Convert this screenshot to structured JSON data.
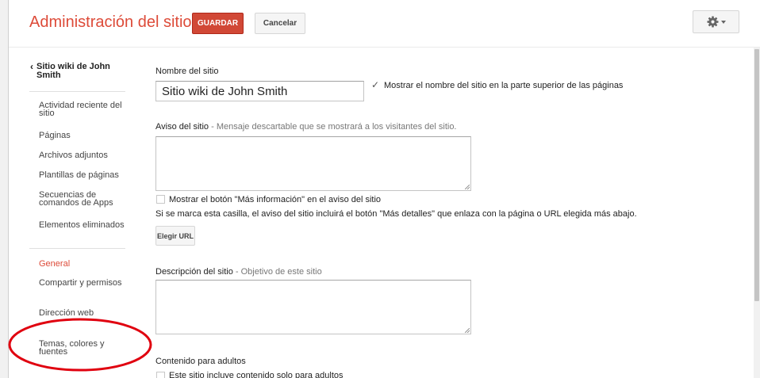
{
  "header": {
    "title": "Administración del sitio",
    "save_label": "GUARDAR",
    "cancel_label": "Cancelar",
    "settings_icon": "gear-icon"
  },
  "sidebar": {
    "back_label": "Sitio wiki de John Smith",
    "group1": [
      {
        "label": "Actividad reciente del sitio"
      },
      {
        "label": "Páginas"
      },
      {
        "label": "Archivos adjuntos"
      },
      {
        "label": "Plantillas de páginas"
      },
      {
        "label": "Secuencias de comandos de Apps"
      },
      {
        "label": "Elementos eliminados"
      }
    ],
    "group2": [
      {
        "label": "General",
        "active": true
      },
      {
        "label": "Compartir y permisos"
      },
      {
        "label": "Dirección web"
      },
      {
        "label": "Temas, colores y fuentes"
      }
    ]
  },
  "form": {
    "site_name_label": "Nombre del sitio",
    "site_name_value": "Sitio wiki de John Smith",
    "show_name_label": "Mostrar el nombre del sitio en la parte superior de las páginas",
    "show_name_checked": true,
    "notice_label": "Aviso del sitio",
    "notice_hint": " - Mensaje descartable que se mostrará a los visitantes del sitio.",
    "more_info_label": "Mostrar el botón \"Más información\" en el aviso del sitio",
    "more_info_checked": false,
    "more_info_help": "Si se marca esta casilla, el aviso del sitio incluirá el botón \"Más detalles\" que enlaza con la página o URL elegida más abajo.",
    "choose_url_label": "Elegir URL",
    "description_label": "Descripción del sitio",
    "description_hint": " - Objetivo de este sitio",
    "adult_label": "Contenido para adultos",
    "adult_checkbox_label": "Este sitio incluye contenido solo para adultos",
    "adult_checked": false
  },
  "colors": {
    "accent": "#dd4b39",
    "save_button": "#d14836",
    "annotation": "#e0000f"
  }
}
